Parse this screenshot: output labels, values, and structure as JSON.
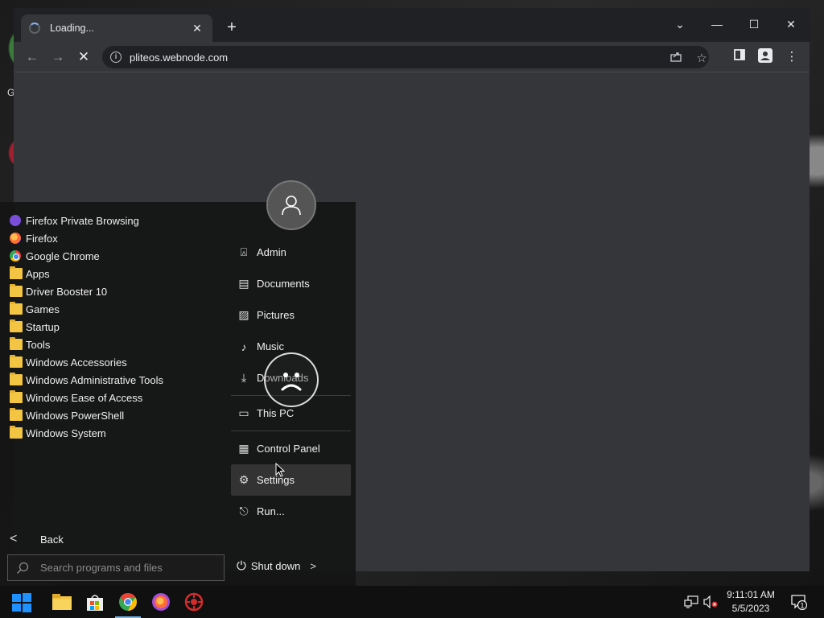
{
  "desktop": {
    "edge_letter": "G"
  },
  "browser": {
    "tab_title": "Loading...",
    "tab_close": "✕",
    "new_tab": "+",
    "url": "pliteos.webnode.com",
    "window_controls": {
      "tablist": "⌄",
      "minimize": "—",
      "maximize": "☐",
      "close": "✕"
    },
    "nav": {
      "back": "←",
      "forward": "→",
      "stop": "✕"
    }
  },
  "start_menu": {
    "programs": [
      {
        "label": "Firefox Private Browsing",
        "icon": "firefox-private-icon"
      },
      {
        "label": "Firefox",
        "icon": "firefox-icon"
      },
      {
        "label": "Google Chrome",
        "icon": "chrome-icon"
      },
      {
        "label": "Apps",
        "icon": "folder-icon"
      },
      {
        "label": "Driver Booster 10",
        "icon": "folder-icon"
      },
      {
        "label": "Games",
        "icon": "folder-icon"
      },
      {
        "label": "Startup",
        "icon": "folder-icon"
      },
      {
        "label": "Tools",
        "icon": "folder-icon"
      },
      {
        "label": "Windows Accessories",
        "icon": "folder-icon"
      },
      {
        "label": "Windows Administrative Tools",
        "icon": "folder-icon"
      },
      {
        "label": "Windows Ease of Access",
        "icon": "folder-icon"
      },
      {
        "label": "Windows PowerShell",
        "icon": "folder-icon"
      },
      {
        "label": "Windows System",
        "icon": "folder-icon"
      }
    ],
    "back_label": "Back",
    "search_placeholder": "Search programs and files",
    "places": [
      {
        "label": "Admin",
        "icon": "user-folder-icon"
      },
      {
        "label": "Documents",
        "icon": "document-icon"
      },
      {
        "label": "Pictures",
        "icon": "picture-icon"
      },
      {
        "label": "Music",
        "icon": "music-icon"
      },
      {
        "label": "Downloads",
        "icon": "download-icon"
      },
      {
        "label": "This PC",
        "icon": "computer-icon"
      },
      {
        "label": "Control Panel",
        "icon": "control-panel-icon"
      },
      {
        "label": "Settings",
        "icon": "gear-icon"
      },
      {
        "label": "Run...",
        "icon": "run-icon"
      }
    ],
    "shutdown_label": "Shut down"
  },
  "taskbar": {
    "time": "9:11:01 AM",
    "date": "5/5/2023",
    "notification_count": "1"
  },
  "colors": {
    "chrome_dark": "#202124",
    "chrome_toolbar": "#35363a",
    "start_menu_bg": "#141414",
    "folder_yellow": "#f4c542",
    "taskbar_bg": "#101010",
    "windows_blue": "#1e90ff"
  }
}
